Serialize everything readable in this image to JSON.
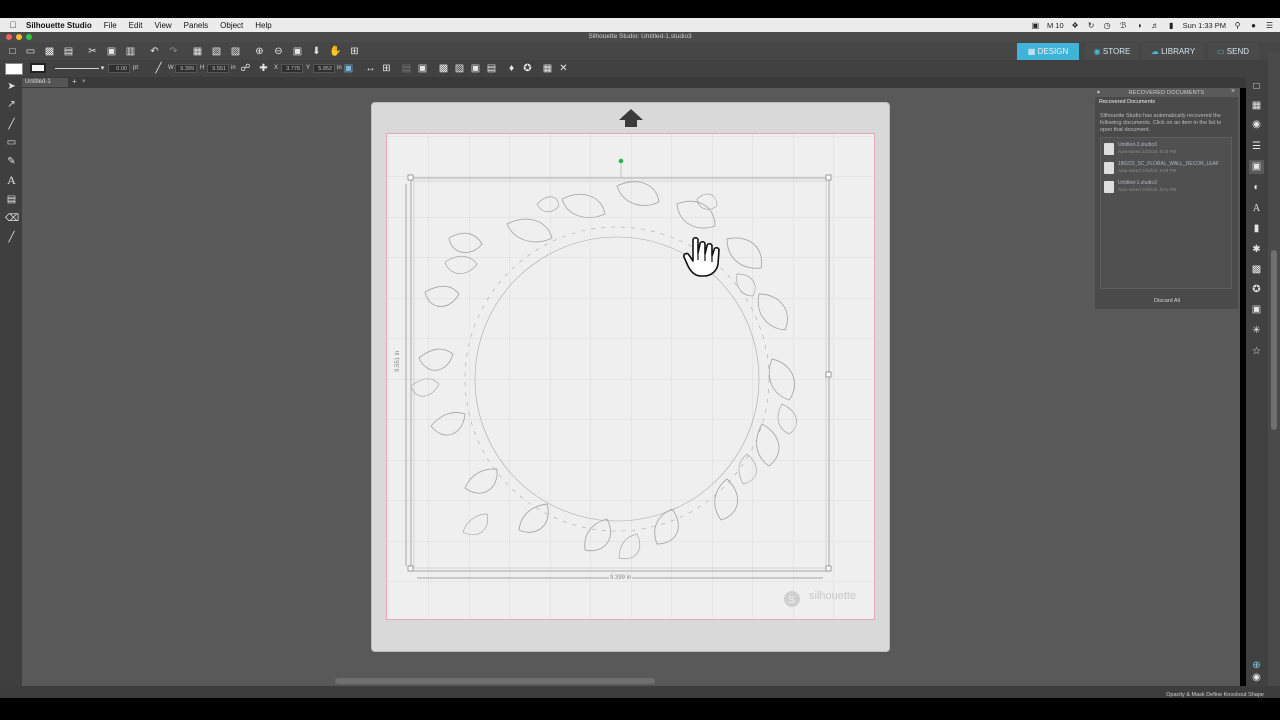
{
  "menubar": {
    "app_name": "Silhouette Studio",
    "items": [
      "File",
      "Edit",
      "View",
      "Panels",
      "Object",
      "Help"
    ],
    "status": {
      "battery_count": "10",
      "clock": "Sun 1:33 PM"
    }
  },
  "window": {
    "title": "Silhouette Studio: Untitled-1.studio3"
  },
  "nav": {
    "design": "DESIGN",
    "store": "STORE",
    "library": "LIBRARY",
    "send": "SEND",
    "active_color": "#3fb3d8"
  },
  "toolbar2": {
    "line_width": "0.00",
    "line_unit": "pt",
    "w_label": "W",
    "w_value": "9.399",
    "h_label": "H",
    "h_value": "9.551",
    "h_unit": "in",
    "x_label": "X",
    "x_value": "3.778",
    "y_label": "Y",
    "y_value": "5.952",
    "y_unit": "in"
  },
  "tabs": {
    "doc_name": "Untitled-1"
  },
  "canvas": {
    "dim_width": "9.399 in",
    "dim_height": "9.551 in",
    "watermark": "silhouette"
  },
  "panel": {
    "title": "RECOVERED DOCUMENTS",
    "subtitle": "Recovered Documents",
    "description": "Silhouette Studio has automatically recovered the following documents. Click on an item in the list to open that document.",
    "files": [
      {
        "name": "Untitled-3.studio3",
        "date": "Auto-saved 1/21/18, 8:43 PM"
      },
      {
        "name": "180222_SC_FLORAL_WALL_DECOR_LEAF",
        "date": "Auto-saved 2/22/18, 8:26 PM"
      },
      {
        "name": "Untitled-1.studio3",
        "date": "Auto-saved 2/25/18, 8:01 PM"
      }
    ],
    "discard_label": "Discard All"
  },
  "statusbar": {
    "hint": "Opacity & Mask Define Knockout Shape"
  },
  "icons": {
    "apple": "apple-logo-icon",
    "hand": "hand-pointer-icon",
    "arrow": "feed-direction-arrow-icon"
  }
}
